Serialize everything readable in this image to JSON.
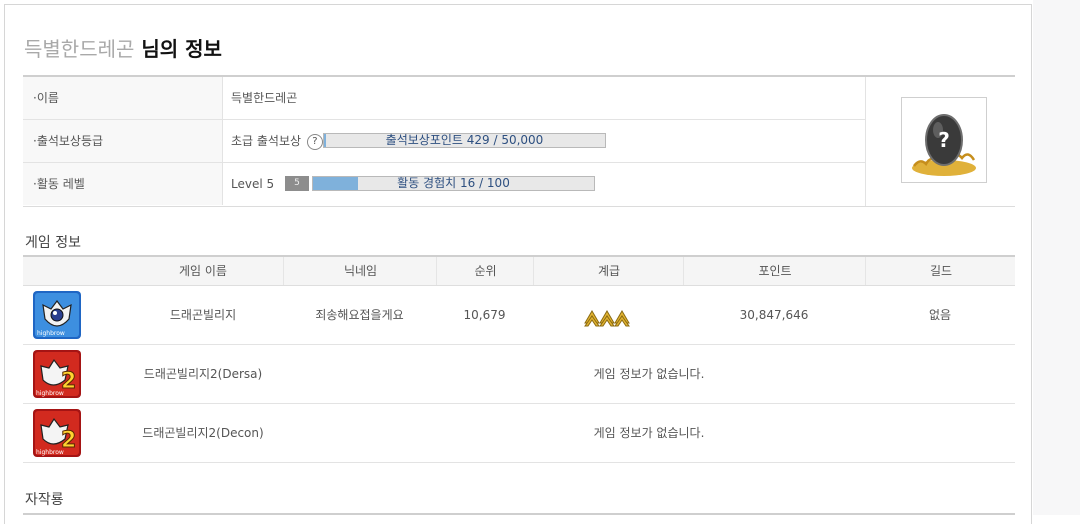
{
  "header": {
    "nickname": "득별한드레곤",
    "suffix": "님의 정보"
  },
  "profile": {
    "name_label": "·이름",
    "name_value": "득별한드레곤",
    "attendance_label": "·출석보상등급",
    "attendance_grade": "초급 출석보상",
    "attendance_help_icon": "?",
    "attendance_bar_text": "출석보상포인트 429 / 50,000",
    "attendance_progress": 0.0086,
    "activity_label": "·활동 레벨",
    "activity_level": "Level 5",
    "activity_badge": "5",
    "activity_bar_text": "활동 경험치 16 / 100",
    "activity_progress": 0.16,
    "avatar_icon": "egg-question-icon"
  },
  "game_info": {
    "title": "게임 정보",
    "columns": [
      "게임 이름",
      "닉네임",
      "순위",
      "계급",
      "포인트",
      "길드"
    ],
    "rows": [
      {
        "icon": "dragon-village-icon",
        "game": "드래곤빌리지",
        "nickname": "죄송해요접을게요",
        "rank": "10,679",
        "grade_icon": "rank-chevrons-icon",
        "points": "30,847,646",
        "guild": "없음"
      },
      {
        "icon": "dragon-village-2-icon",
        "game": "드래곤빌리지2(Dersa)",
        "message": "게임 정보가 없습니다."
      },
      {
        "icon": "dragon-village-2-icon",
        "game": "드래곤빌리지2(Decon)",
        "message": "게임 정보가 없습니다."
      }
    ]
  },
  "works": {
    "title": "자작룡"
  },
  "colors": {
    "progress_fill": "#7fb1db",
    "progress_text": "#2d4f80",
    "grade_gold": "#d9a521"
  }
}
